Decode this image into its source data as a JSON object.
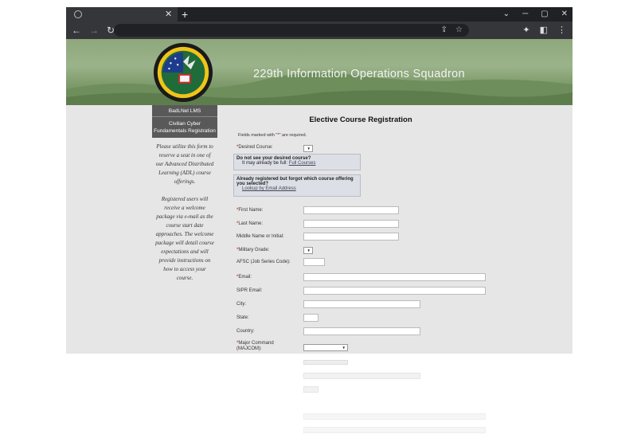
{
  "browser": {
    "tab_close": "✕",
    "new_tab": "+",
    "min": "─",
    "max": "▢",
    "close": "✕",
    "back": "←",
    "forward": "→",
    "reload": "↻",
    "share": "⇪",
    "star": "☆",
    "ext": "✦",
    "panel": "◧",
    "menu": "⋮"
  },
  "banner": {
    "title": "229th Information Operations Squadron",
    "patch_top": "FACILITAS IN DISCIPULIS",
    "patch_bottom": "229th INFORMATION OP SQ"
  },
  "sidebar": {
    "lms": "BadLNet LMS",
    "section": "Civilian Cyber Fundamentals Registration",
    "para1": "Please utilize this form to reserve a seat in one of our Advanced Distributed Learning (ADL) course offerings.",
    "para2": "Registered users will receive a welcome package via e-mail as the course start date approaches. The welcome package will detail course expectations and will provide instructions on how to access your course."
  },
  "form": {
    "title": "Elective Course Registration",
    "note_pre": "Fields marked with \"",
    "note_star": "*",
    "note_post": "\" are required.",
    "desired_course": "Desired Course:",
    "box1_title": "Do not see your desired course?",
    "box1_text": "It may already be full: ",
    "box1_link": "Full Courses",
    "box2_title": "Already registered but forgot which course offering you selected?",
    "box2_link": "Lookup by Email Address",
    "first_name": "First Name:",
    "last_name": "Last Name:",
    "middle_name": "Middle Name or Initial:",
    "military_grade": "Military Grade:",
    "afsc": "AFSC (Job Series Code):",
    "email": "Email:",
    "sipr_email": "SIPR Email:",
    "city": "City:",
    "state": "State:",
    "country": "Country:",
    "majcom": "Major Command (MAJCOM):",
    "star": "*",
    "arrow": "▼"
  }
}
